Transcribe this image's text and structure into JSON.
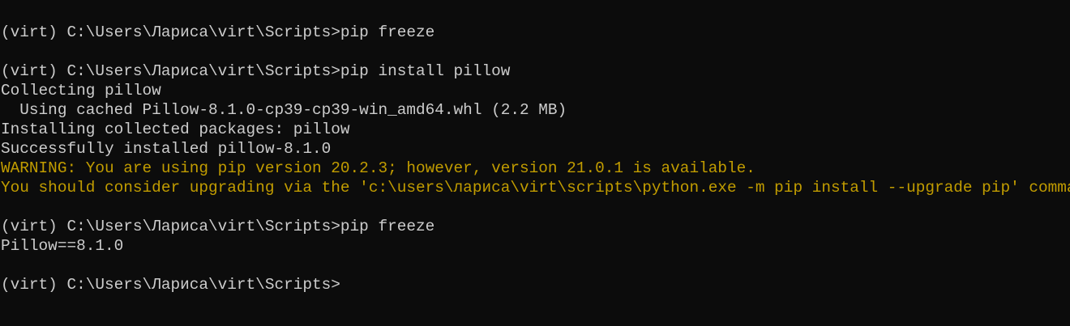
{
  "terminal": {
    "colors": {
      "background": "#0c0c0c",
      "text": "#cccccc",
      "warning": "#c19c00"
    },
    "lines": [
      {
        "kind": "prompt",
        "text": "(virt) C:\\Users\\Лариса\\virt\\Scripts>pip freeze"
      },
      {
        "kind": "blank",
        "text": ""
      },
      {
        "kind": "prompt",
        "text": "(virt) C:\\Users\\Лариса\\virt\\Scripts>pip install pillow"
      },
      {
        "kind": "output",
        "text": "Collecting pillow"
      },
      {
        "kind": "output",
        "text": "  Using cached Pillow-8.1.0-cp39-cp39-win_amd64.whl (2.2 MB)"
      },
      {
        "kind": "output",
        "text": "Installing collected packages: pillow"
      },
      {
        "kind": "output",
        "text": "Successfully installed pillow-8.1.0"
      },
      {
        "kind": "warning",
        "text": "WARNING: You are using pip version 20.2.3; however, version 21.0.1 is available."
      },
      {
        "kind": "warning",
        "text": "You should consider upgrading via the 'c:\\users\\лариса\\virt\\scripts\\python.exe -m pip install --upgrade pip' command."
      },
      {
        "kind": "blank",
        "text": ""
      },
      {
        "kind": "prompt",
        "text": "(virt) C:\\Users\\Лариса\\virt\\Scripts>pip freeze"
      },
      {
        "kind": "output",
        "text": "Pillow==8.1.0"
      },
      {
        "kind": "blank",
        "text": ""
      },
      {
        "kind": "prompt",
        "text": "(virt) C:\\Users\\Лариса\\virt\\Scripts>"
      }
    ]
  }
}
